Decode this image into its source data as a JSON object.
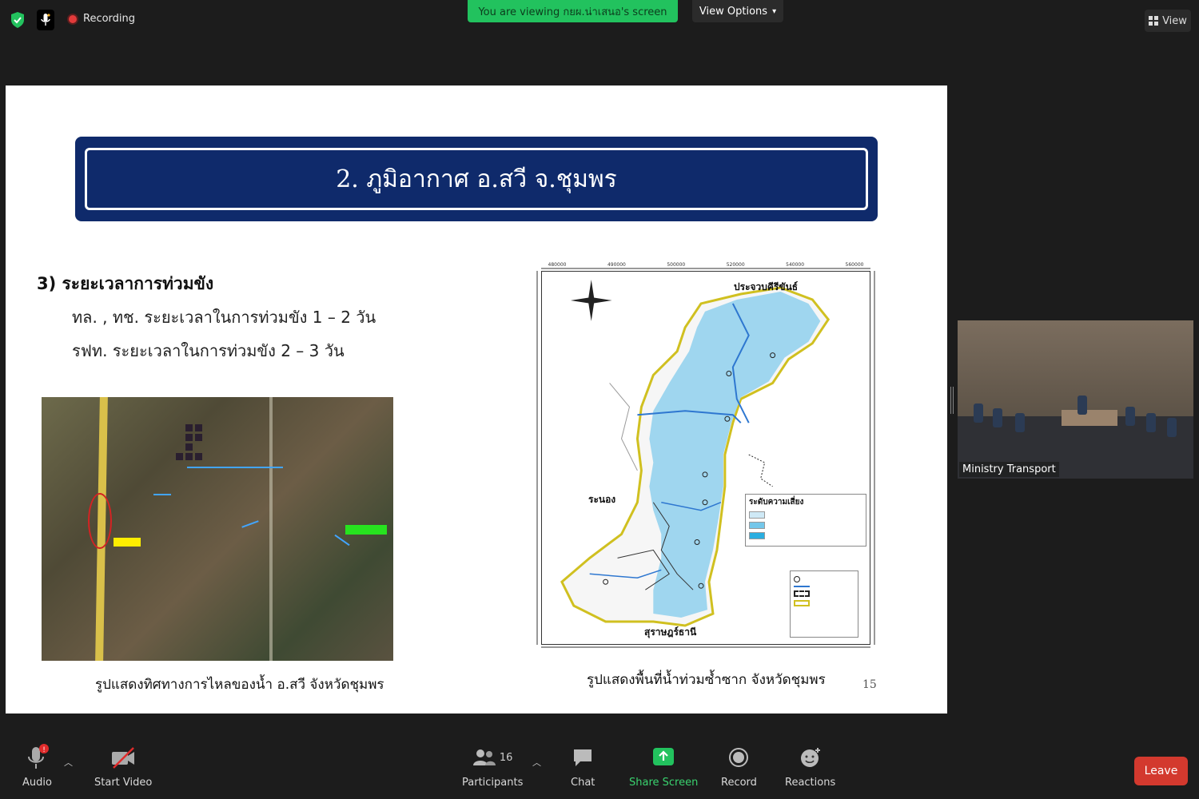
{
  "topbar": {
    "recording_label": "Recording",
    "viewing_banner": "You are viewing กยผ.น่าเสนอ's screen",
    "view_options_label": "View Options",
    "view_label": "View"
  },
  "slide": {
    "title": "2. ภูมิอากาศ อ.สวี จ.ชุมพร",
    "heading": "3) ระยะเวลาการท่วมขัง",
    "line1": "ทล. , ทช. ระยะเวลาในการท่วมขัง 1 – 2 วัน",
    "line2": "รฟท. ระยะเวลาในการท่วมขัง 2 – 3 วัน",
    "caption_left": "รูปแสดงทิศทางการไหลของน้ำ อ.สวี จังหวัดชุมพร",
    "caption_right": "รูปแสดงพื้นที่น้ำท่วมซ้ำซาก จังหวัดชุมพร",
    "page_number": "15",
    "map": {
      "label_north": "ประจวบคีรีขันธ์",
      "label_west": "ระนอง",
      "label_south": "สุราษฎร์ธานี",
      "risk_legend_title": "ระดับความเสี่ยง",
      "axis_top_ticks": [
        "480000",
        "490000",
        "500000",
        "520000",
        "540000",
        "560000"
      ]
    }
  },
  "video": {
    "participant_name": "Ministry Transport"
  },
  "toolbar": {
    "audio_label": "Audio",
    "start_video_label": "Start Video",
    "participants_label": "Participants",
    "participants_count": "16",
    "chat_label": "Chat",
    "share_screen_label": "Share Screen",
    "record_label": "Record",
    "reactions_label": "Reactions",
    "leave_label": "Leave"
  },
  "colors": {
    "viewing_banner": "#22c25e",
    "share_screen": "#22c25e",
    "leave": "#d3392e",
    "slide_title_bg": "#0f2a6b",
    "map_flood": "#9fd6ef"
  }
}
